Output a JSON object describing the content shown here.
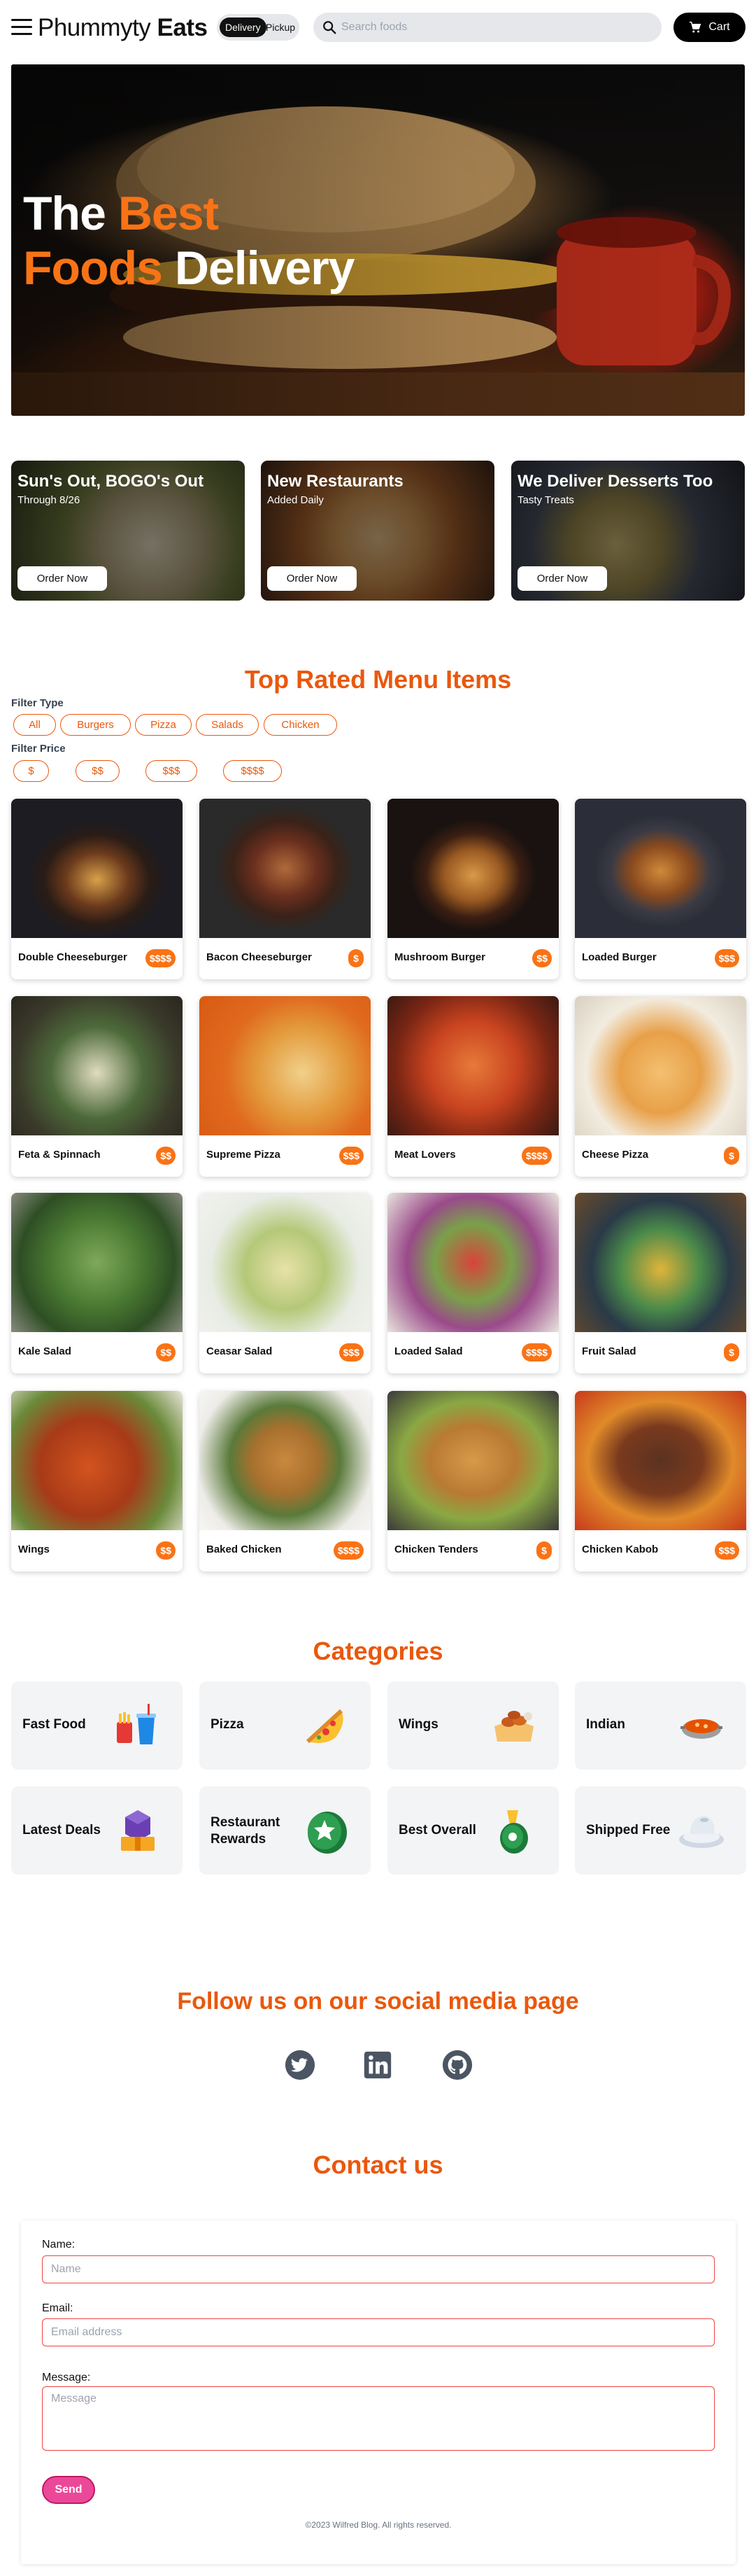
{
  "header": {
    "brand_light": "Phummyty",
    "brand_bold": "Eats",
    "delivery_label": "Delivery",
    "pickup_label": "Pickup",
    "search_placeholder": "Search foods",
    "cart_label": "Cart",
    "menu_icon": "hamburger-menu-icon",
    "search_icon": "search-icon",
    "cart_icon": "cart-icon"
  },
  "hero": {
    "line1_plain": "The",
    "line1_accent": "Best",
    "line2_accent": "Foods",
    "line2_plain": "Delivery"
  },
  "promos": [
    {
      "title": "Sun's Out, BOGO's Out",
      "subtitle": "Through 8/26",
      "button": "Order Now"
    },
    {
      "title": "New Restaurants",
      "subtitle": "Added Daily",
      "button": "Order Now"
    },
    {
      "title": "We Deliver Desserts Too",
      "subtitle": "Tasty Treats",
      "button": "Order Now"
    }
  ],
  "menu_section": {
    "title": "Top Rated Menu Items",
    "filter_type_label": "Filter Type",
    "filter_types": [
      "All",
      "Burgers",
      "Pizza",
      "Salads",
      "Chicken"
    ],
    "filter_price_label": "Filter Price",
    "filter_prices": [
      "$",
      "$$",
      "$$$",
      "$$$$"
    ]
  },
  "menu_items": [
    {
      "name": "Double Cheeseburger",
      "price": "$$$$"
    },
    {
      "name": "Bacon Cheeseburger",
      "price": "$"
    },
    {
      "name": "Mushroom Burger",
      "price": "$$"
    },
    {
      "name": "Loaded Burger",
      "price": "$$$"
    },
    {
      "name": "Feta & Spinnach",
      "price": "$$"
    },
    {
      "name": "Supreme Pizza",
      "price": "$$$"
    },
    {
      "name": "Meat Lovers",
      "price": "$$$$"
    },
    {
      "name": "Cheese Pizza",
      "price": "$"
    },
    {
      "name": "Kale Salad",
      "price": "$$"
    },
    {
      "name": "Ceasar Salad",
      "price": "$$$"
    },
    {
      "name": "Loaded Salad",
      "price": "$$$$"
    },
    {
      "name": "Fruit Salad",
      "price": "$"
    },
    {
      "name": "Wings",
      "price": "$$"
    },
    {
      "name": "Baked Chicken",
      "price": "$$$$"
    },
    {
      "name": "Chicken Tenders",
      "price": "$"
    },
    {
      "name": "Chicken Kabob",
      "price": "$$$"
    }
  ],
  "categories_section": {
    "title": "Categories",
    "items": [
      {
        "name": "Fast Food",
        "icon": "fast-food-icon"
      },
      {
        "name": "Pizza",
        "icon": "pizza-icon"
      },
      {
        "name": "Wings",
        "icon": "wings-icon"
      },
      {
        "name": "Indian",
        "icon": "indian-food-icon"
      },
      {
        "name": "Latest Deals",
        "icon": "deals-icon"
      },
      {
        "name": "Restaurant Rewards",
        "icon": "rewards-icon"
      },
      {
        "name": "Best Overall",
        "icon": "best-overall-icon"
      },
      {
        "name": "Shipped Free",
        "icon": "shipped-free-icon"
      }
    ]
  },
  "social_section": {
    "title": "Follow us on our social media page",
    "icons": [
      "twitter-icon",
      "linkedin-icon",
      "github-icon"
    ]
  },
  "contact_section": {
    "title": "Contact us",
    "name_label": "Name:",
    "name_placeholder": "Name",
    "email_label": "Email:",
    "email_placeholder": "Email address",
    "message_label": "Message:",
    "message_placeholder": "Message",
    "send_label": "Send",
    "copyright": "©2023 Wilfred Blog. All rights reserved."
  },
  "colors": {
    "accent": "#ea580c",
    "price_badge": "#f97316",
    "send_button": "#ec4899"
  }
}
